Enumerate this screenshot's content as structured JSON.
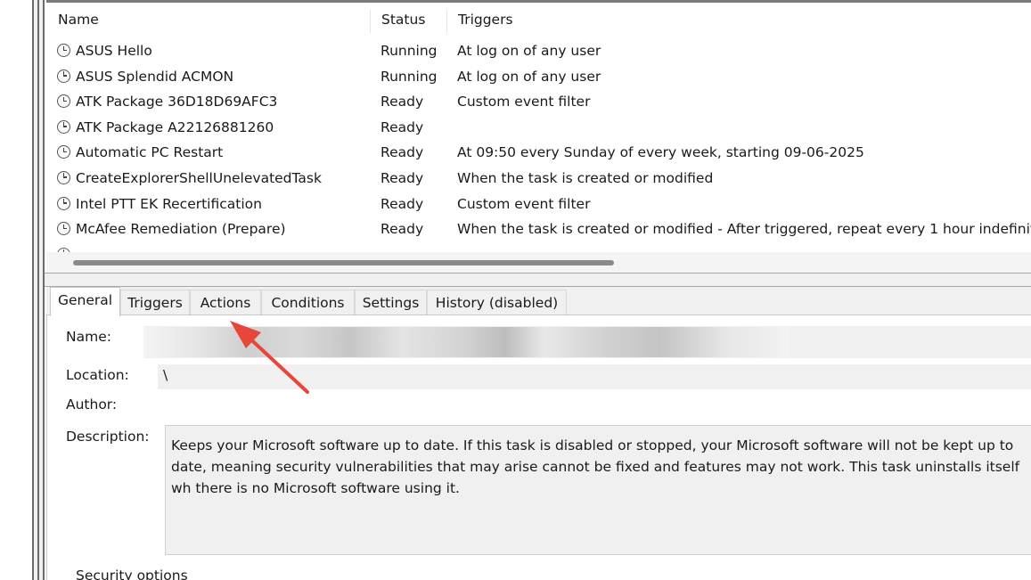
{
  "task_list": {
    "columns": [
      "Name",
      "Status",
      "Triggers"
    ],
    "rows": [
      {
        "name": "ASUS Hello",
        "status": "Running",
        "trigger": "At log on of any user"
      },
      {
        "name": "ASUS Splendid ACMON",
        "status": "Running",
        "trigger": "At log on of any user"
      },
      {
        "name": "ATK Package 36D18D69AFC3",
        "status": "Ready",
        "trigger": "Custom event filter"
      },
      {
        "name": "ATK Package A22126881260",
        "status": "Ready",
        "trigger": ""
      },
      {
        "name": "Automatic PC Restart",
        "status": "Ready",
        "trigger": "At 09:50 every Sunday of every week, starting 09-06-2025"
      },
      {
        "name": "CreateExplorerShellUnelevatedTask",
        "status": "Ready",
        "trigger": "When the task is created or modified"
      },
      {
        "name": "Intel PTT EK Recertification",
        "status": "Ready",
        "trigger": "Custom event filter"
      },
      {
        "name": "McAfee Remediation (Prepare)",
        "status": "Ready",
        "trigger": "When the task is created or modified - After triggered, repeat every 1 hour indefinit"
      }
    ],
    "icon": "clock-icon"
  },
  "tabs": [
    "General",
    "Triggers",
    "Actions",
    "Conditions",
    "Settings",
    "History (disabled)"
  ],
  "active_tab": "General",
  "general": {
    "name_label": "Name:",
    "location_label": "Location:",
    "location_value": "\\",
    "author_label": "Author:",
    "description_label": "Description:",
    "description": "Keeps your Microsoft software up to date. If this task is disabled or stopped, your Microsoft software will not be kept up to date, meaning security vulnerabilities that may arise cannot be fixed and features may not work. This task uninstalls itself wh there is no Microsoft software using it.",
    "security_options_label": "Security options"
  },
  "annotation": {
    "type": "arrow",
    "color": "#e8463a",
    "points_to": "Actions tab"
  },
  "colors": {
    "pane_bg": "#f0f0f0",
    "border": "#7a7a7a"
  }
}
